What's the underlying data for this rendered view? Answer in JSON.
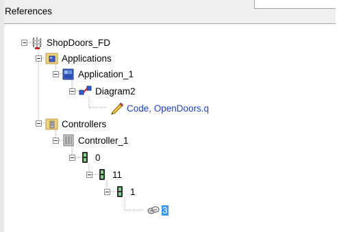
{
  "panel": {
    "title": "References"
  },
  "tree": {
    "root": {
      "label": "ShopDoors_FD",
      "icon": "project-icon"
    },
    "applications": {
      "label": "Applications",
      "icon": "applications-folder-icon"
    },
    "application_1": {
      "label": "Application_1",
      "icon": "application-icon"
    },
    "diagram2": {
      "label": "Diagram2",
      "icon": "diagram-icon"
    },
    "code": {
      "label": "Code, OpenDoors.q",
      "icon": "pencil-icon",
      "color": "#1c3fd8"
    },
    "controllers": {
      "label": "Controllers",
      "icon": "controllers-folder-icon"
    },
    "controller_1": {
      "label": "Controller_1",
      "icon": "controller-icon"
    },
    "slot_0": {
      "label": "0",
      "icon": "module-icon"
    },
    "slot_11": {
      "label": "11",
      "icon": "module-icon"
    },
    "slot_1": {
      "label": "1",
      "icon": "module-icon"
    },
    "item_3": {
      "label": "3",
      "icon": "io-link-icon",
      "selected": true
    }
  }
}
